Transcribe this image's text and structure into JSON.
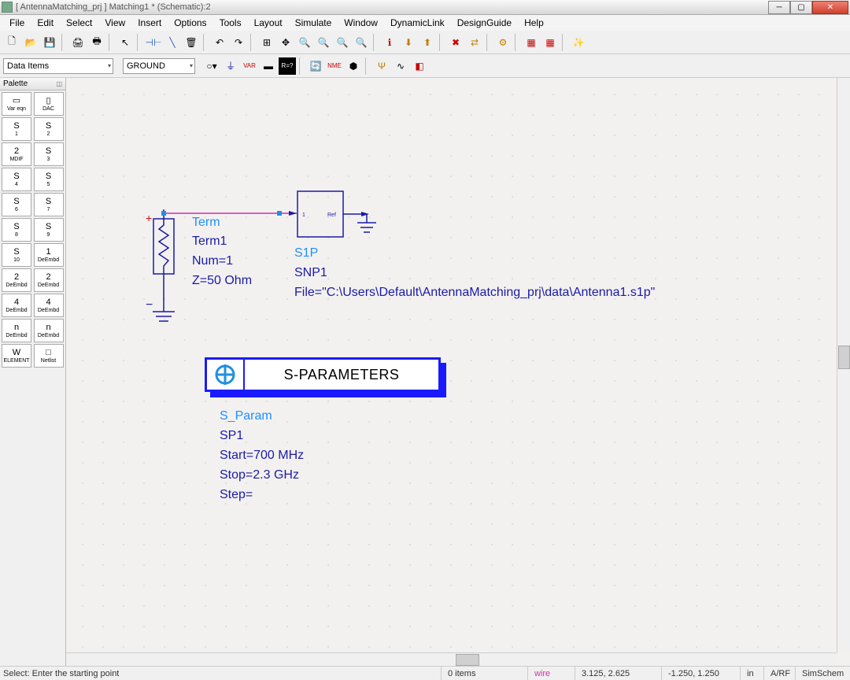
{
  "titlebar": {
    "title": "[ AntennaMatching_prj ] Matching1 * (Schematic):2"
  },
  "menus": [
    "File",
    "Edit",
    "Select",
    "View",
    "Insert",
    "Options",
    "Tools",
    "Layout",
    "Simulate",
    "Window",
    "DynamicLink",
    "DesignGuide",
    "Help"
  ],
  "combo1": "Data Items",
  "combo2": "GROUND",
  "palette": {
    "title": "Palette"
  },
  "palette_items": [
    {
      "t": "Var eqn",
      "ic": "▭"
    },
    {
      "t": "DAC",
      "ic": "▯"
    },
    {
      "t": "1",
      "ic": "S"
    },
    {
      "t": "2",
      "ic": "S"
    },
    {
      "t": "MDIF",
      "ic": "2"
    },
    {
      "t": "3",
      "ic": "S"
    },
    {
      "t": "4",
      "ic": "S"
    },
    {
      "t": "5",
      "ic": "S"
    },
    {
      "t": "6",
      "ic": "S"
    },
    {
      "t": "7",
      "ic": "S"
    },
    {
      "t": "8",
      "ic": "S"
    },
    {
      "t": "9",
      "ic": "S"
    },
    {
      "t": "10",
      "ic": "S"
    },
    {
      "t": "DeEmbd",
      "ic": "1"
    },
    {
      "t": "DeEmbd",
      "ic": "2"
    },
    {
      "t": "DeEmbd",
      "ic": "2"
    },
    {
      "t": "DeEmbd",
      "ic": "4"
    },
    {
      "t": "DeEmbd",
      "ic": "4"
    },
    {
      "t": "DeEmbd",
      "ic": "n"
    },
    {
      "t": "DeEmbd",
      "ic": "n"
    },
    {
      "t": "ELEMENT",
      "ic": "W"
    },
    {
      "t": "Netlist",
      "ic": "□"
    }
  ],
  "term": {
    "name": "Term",
    "inst": "Term1",
    "num": "Num=1",
    "z": "Z=50 Ohm"
  },
  "s1p": {
    "name": "S1P",
    "inst": "SNP1",
    "boxlabel": "Ref",
    "file": "File=\"C:\\Users\\Default\\AntennaMatching_prj\\data\\Antenna1.s1p\""
  },
  "sparam": {
    "header": "S-PARAMETERS",
    "name": "S_Param",
    "inst": "SP1",
    "start": "Start=700 MHz",
    "stop": "Stop=2.3 GHz",
    "step": "Step="
  },
  "status": {
    "hint": "Select: Enter the starting point",
    "items": "0 items",
    "mode": "wire",
    "coord1": "3.125, 2.625",
    "coord2": "-1.250, 1.250",
    "unit": "in",
    "profile": "A/RF",
    "sim": "SimSchem"
  }
}
